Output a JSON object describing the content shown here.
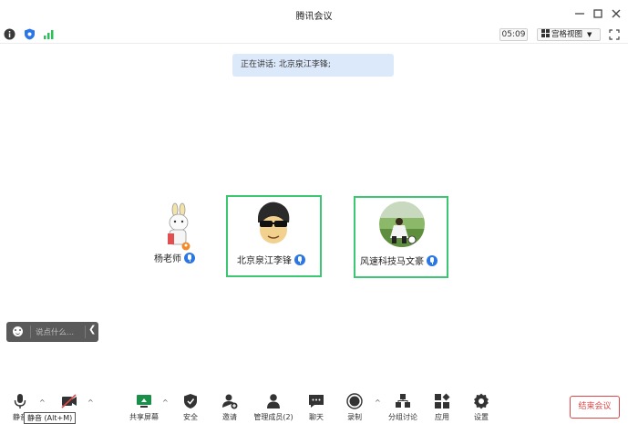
{
  "window": {
    "title": "腾讯会议"
  },
  "infobar": {
    "timer": "05:09",
    "view_label": "宫格视图"
  },
  "speaking": {
    "text": "正在讲话: 北京泉江李锋;"
  },
  "participants": [
    {
      "name": "杨老师",
      "active": false
    },
    {
      "name": "北京泉江李锋",
      "active": true
    },
    {
      "name": "风速科技马文豪",
      "active": true
    }
  ],
  "chat": {
    "placeholder": "说点什么..."
  },
  "toolbar": {
    "mute": "静音",
    "video": "",
    "share": "共享屏幕",
    "security": "安全",
    "invite": "邀请",
    "members": "管理成员(2)",
    "chat": "聊天",
    "record": "录制",
    "breakout": "分组讨论",
    "apps": "应用",
    "settings": "设置",
    "end": "结束会议"
  },
  "tooltip": {
    "text": "静音 (Alt+M)"
  },
  "colors": {
    "accent": "#2b76e5",
    "active_border": "#3ec772",
    "end": "#e04848",
    "banner": "#dce9fb"
  }
}
